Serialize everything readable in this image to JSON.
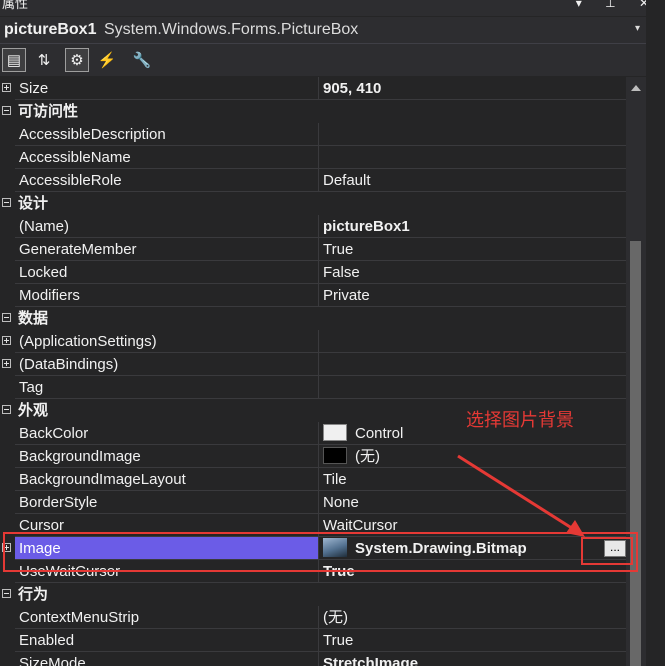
{
  "window": {
    "title": "属性",
    "buttons": "▾ ⊥ ✕"
  },
  "object_selector": {
    "name": "pictureBox1",
    "type": "System.Windows.Forms.PictureBox",
    "dropdown": "▾"
  },
  "toolbar": {
    "buttons": [
      {
        "name": "categorized",
        "glyph": "▤"
      },
      {
        "name": "alphabetical",
        "glyph": "⇅"
      },
      {
        "name": "properties",
        "glyph": "⚙"
      },
      {
        "name": "events",
        "glyph": "⚡"
      },
      {
        "name": "property-pages",
        "glyph": "🔧"
      }
    ]
  },
  "grid": {
    "size_row": {
      "name": "Size",
      "value": "905, 410"
    },
    "cat_accessibility": "可访问性",
    "accessibility": [
      {
        "name": "AccessibleDescription",
        "value": ""
      },
      {
        "name": "AccessibleName",
        "value": ""
      },
      {
        "name": "AccessibleRole",
        "value": "Default"
      }
    ],
    "cat_design": "设计",
    "design": [
      {
        "name": "(Name)",
        "value": "pictureBox1"
      },
      {
        "name": "GenerateMember",
        "value": "True"
      },
      {
        "name": "Locked",
        "value": "False"
      },
      {
        "name": "Modifiers",
        "value": "Private"
      }
    ],
    "cat_data": "数据",
    "data": [
      {
        "name": "(ApplicationSettings)",
        "value": ""
      },
      {
        "name": "(DataBindings)",
        "value": ""
      },
      {
        "name": "Tag",
        "value": ""
      }
    ],
    "cat_appearance": "外观",
    "appearance": [
      {
        "name": "BackColor",
        "value": "Control",
        "swatch": "#f0f0f0"
      },
      {
        "name": "BackgroundImage",
        "value": "(无)",
        "swatch": "#000000"
      },
      {
        "name": "BackgroundImageLayout",
        "value": "Tile"
      },
      {
        "name": "BorderStyle",
        "value": "None"
      },
      {
        "name": "Cursor",
        "value": "WaitCursor"
      },
      {
        "name": "Image",
        "value": "System.Drawing.Bitmap",
        "button": "..."
      },
      {
        "name": "UseWaitCursor",
        "value": "True"
      }
    ],
    "cat_behavior": "行为",
    "behavior": [
      {
        "name": "ContextMenuStrip",
        "value": "(无)"
      },
      {
        "name": "Enabled",
        "value": "True"
      },
      {
        "name": "SizeMode",
        "value": "StretchImage"
      }
    ]
  },
  "annotation": {
    "text": "选择图片背景",
    "color": "#e53935"
  },
  "colors": {
    "selection": "#6b5ce7",
    "background": "#252526",
    "panel": "#2d2d30"
  }
}
